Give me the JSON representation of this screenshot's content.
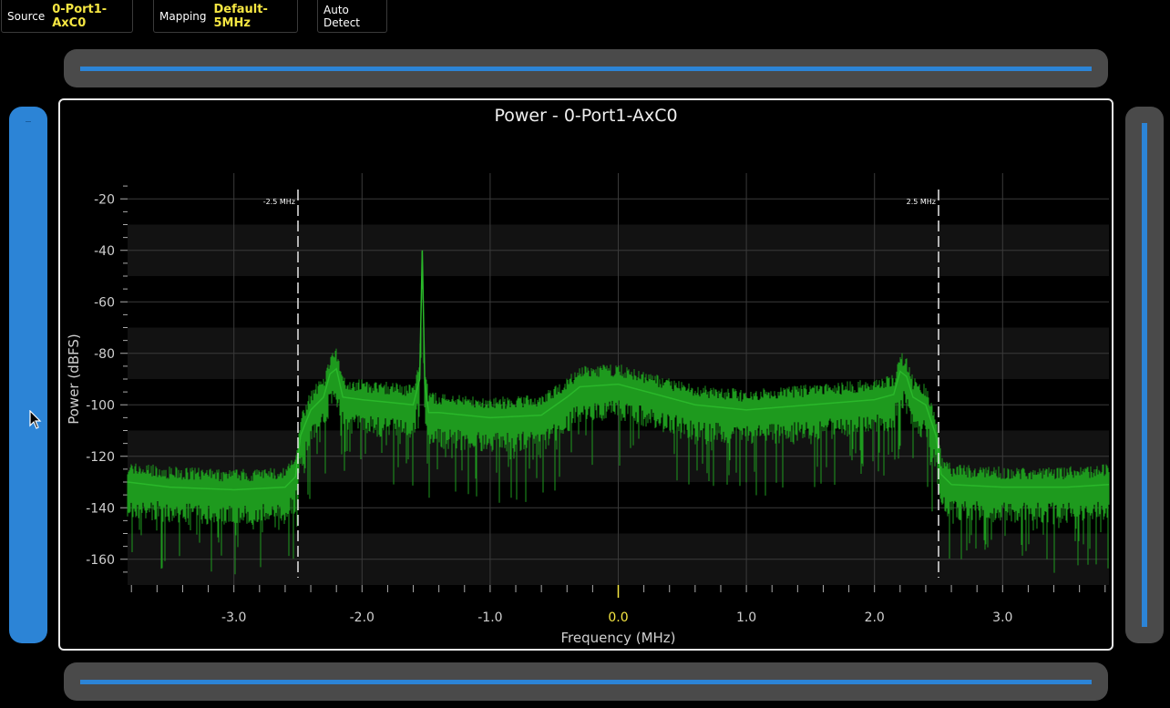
{
  "toolbar": {
    "source_label": "Source",
    "source_value": "0-Port1-AxC0",
    "mapping_label": "Mapping",
    "mapping_value": "Default-5MHz",
    "auto_detect_label": "Auto Detect"
  },
  "colors": {
    "accent_blue": "#2c84d6",
    "value_yellow": "#f5e642",
    "trace_green": "#1e9a1e",
    "slider_gray": "#4a4a4a"
  },
  "chart_data": {
    "type": "line",
    "title": "Power - 0-Port1-AxC0",
    "xlabel": "Frequency (MHz)",
    "ylabel": "Power (dBFS)",
    "xlim": [
      -3.83,
      3.83
    ],
    "ylim": [
      -170,
      -10
    ],
    "x_ticks": [
      -3.0,
      -2.0,
      -1.0,
      0.0,
      1.0,
      2.0,
      3.0
    ],
    "x_tick_labels": [
      "-3.0",
      "-2.0",
      "-1.0",
      "0.0",
      "1.0",
      "2.0",
      "3.0"
    ],
    "y_ticks": [
      -20,
      -40,
      -60,
      -80,
      -100,
      -120,
      -140,
      -160
    ],
    "y_tick_labels": [
      "-20",
      "-40",
      "-60",
      "-80",
      "-100",
      "-120",
      "-140",
      "-160"
    ],
    "grid": true,
    "highlight_tick": "0.0",
    "markers": [
      {
        "x": -2.5,
        "label": "-2.5 MHz"
      },
      {
        "x": 2.5,
        "label": "2.5 MHz"
      }
    ],
    "series": [
      {
        "color": "#1e9a1e",
        "x": [
          -3.83,
          -3.5,
          -3.0,
          -2.6,
          -2.52,
          -2.48,
          -2.4,
          -2.3,
          -2.25,
          -2.2,
          -2.15,
          -2.0,
          -1.8,
          -1.6,
          -1.55,
          -1.53,
          -1.51,
          -1.48,
          -1.4,
          -1.0,
          -0.6,
          -0.4,
          -0.3,
          0.0,
          0.3,
          0.6,
          1.0,
          1.5,
          2.0,
          2.15,
          2.2,
          2.25,
          2.3,
          2.4,
          2.48,
          2.52,
          2.6,
          3.0,
          3.5,
          3.83
        ],
        "y": [
          -130,
          -132,
          -133,
          -132,
          -128,
          -112,
          -102,
          -97,
          -88,
          -86,
          -97,
          -98,
          -99,
          -100,
          -90,
          -40,
          -92,
          -103,
          -103,
          -105,
          -104,
          -97,
          -93,
          -92,
          -96,
          -100,
          -102,
          -100,
          -98,
          -96,
          -87,
          -89,
          -97,
          -100,
          -112,
          -127,
          -131,
          -132,
          -132,
          -131
        ]
      }
    ]
  }
}
